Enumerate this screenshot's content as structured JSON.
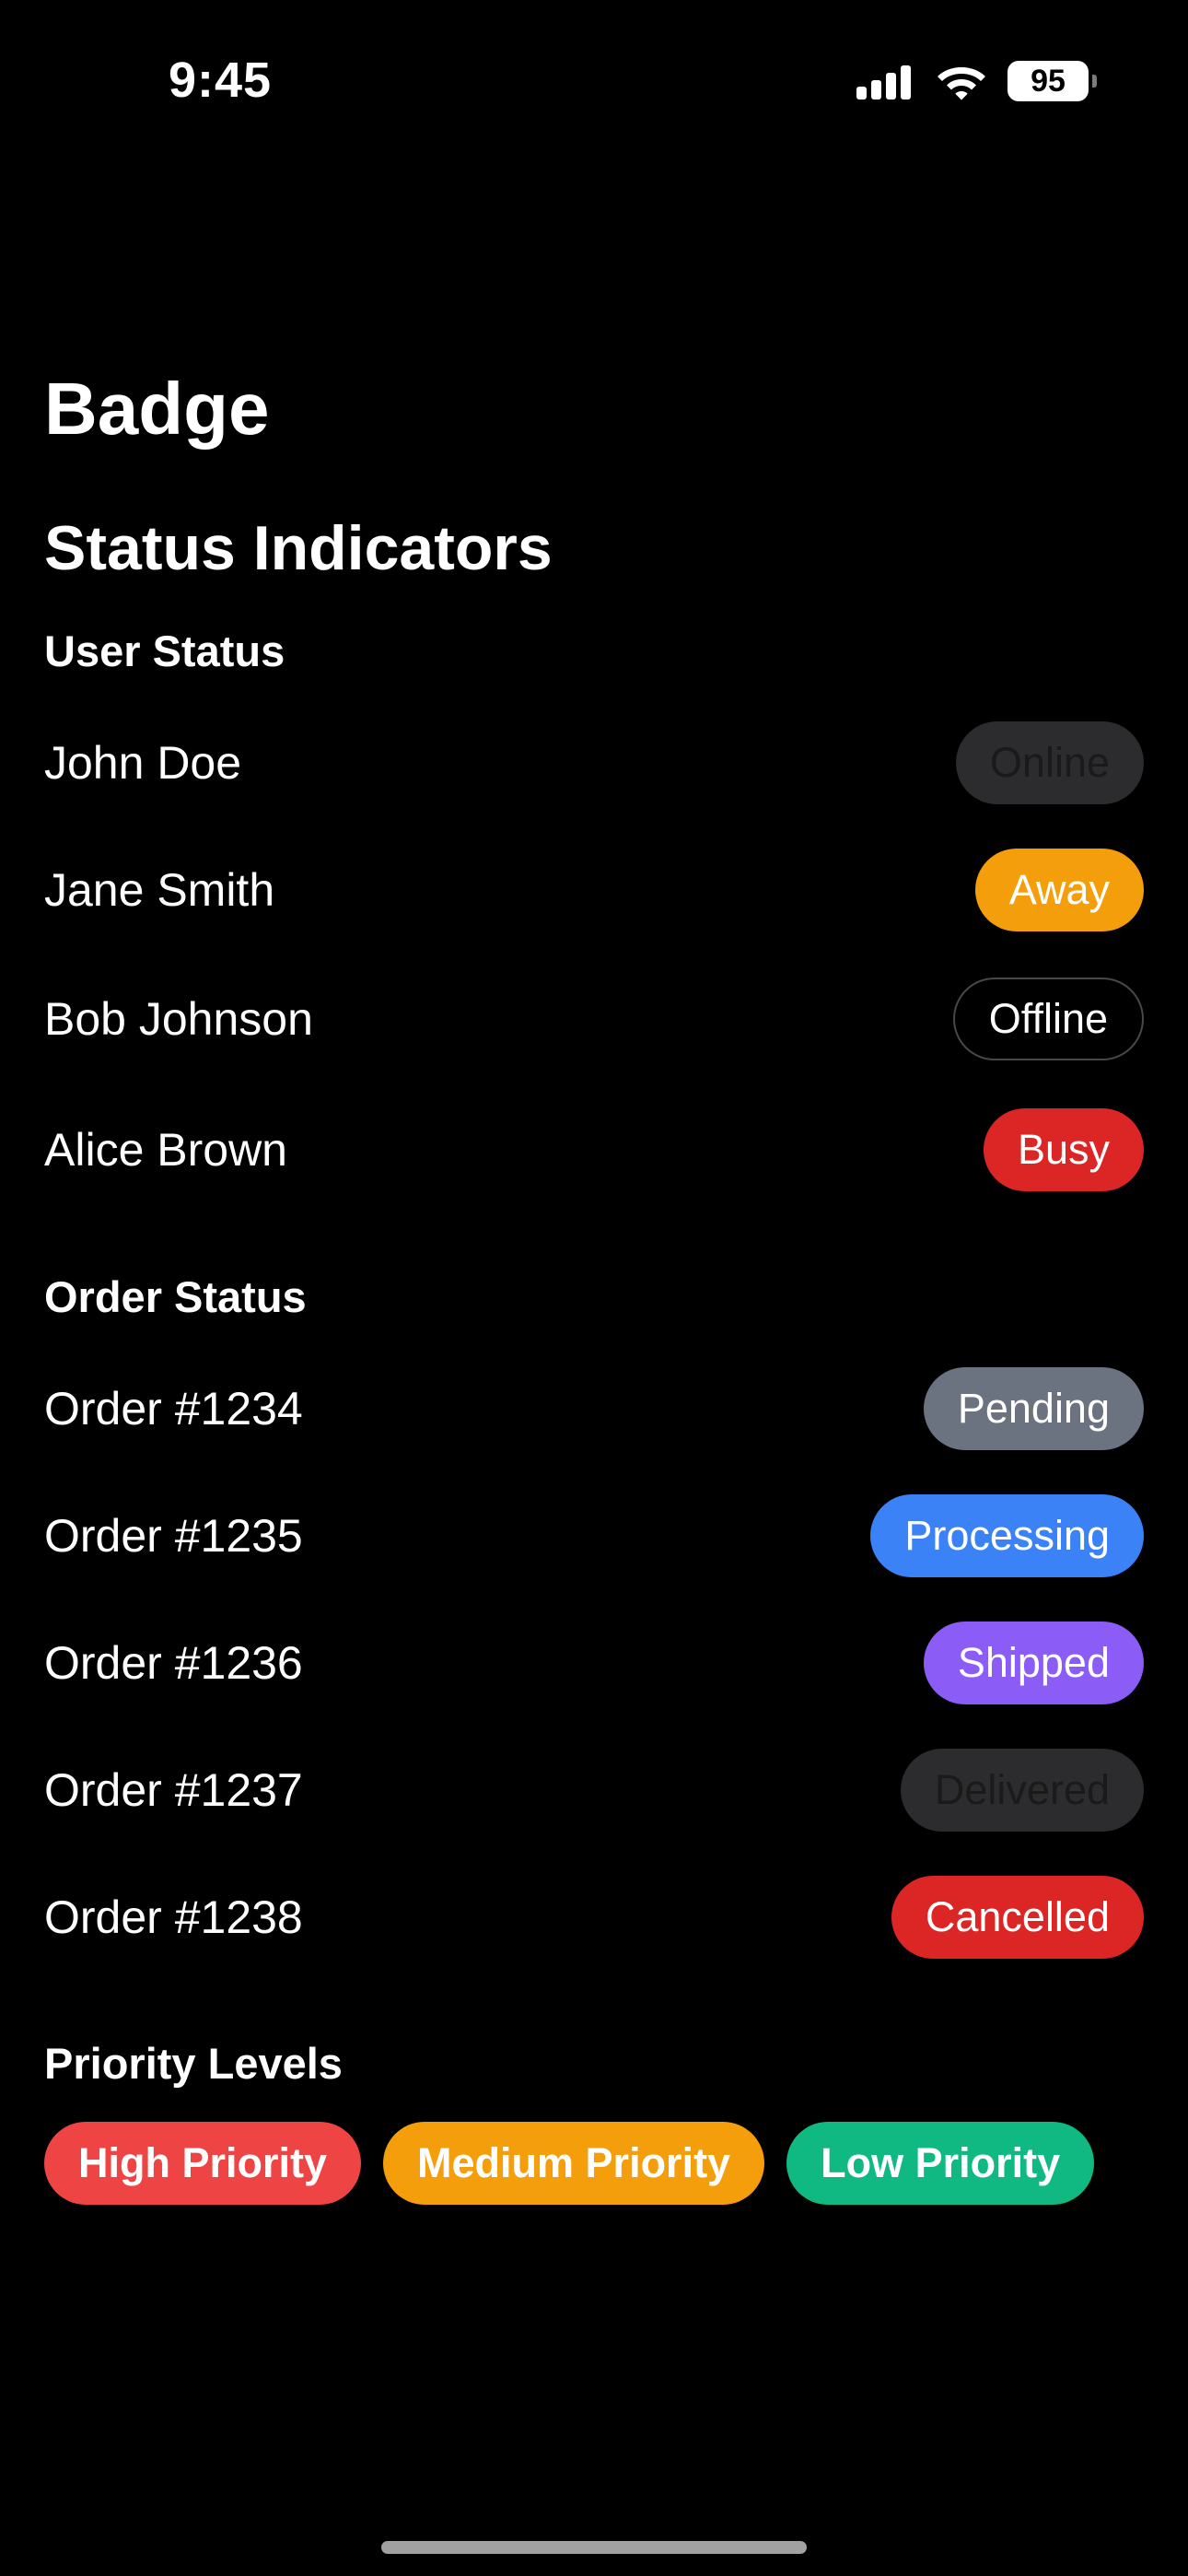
{
  "status_bar": {
    "time": "9:45",
    "battery_level": "95",
    "icons": [
      "signal-icon",
      "wifi-icon",
      "battery-icon"
    ]
  },
  "page": {
    "title": "Badge",
    "section_title": "Status Indicators"
  },
  "user_status": {
    "heading": "User Status",
    "rows": [
      {
        "name": "John Doe",
        "badge": "Online",
        "color": "#2c2c2e"
      },
      {
        "name": "Jane Smith",
        "badge": "Away",
        "color": "#f59e0b"
      },
      {
        "name": "Bob Johnson",
        "badge": "Offline",
        "color": "#000000"
      },
      {
        "name": "Alice Brown",
        "badge": "Busy",
        "color": "#dc2626"
      }
    ]
  },
  "order_status": {
    "heading": "Order Status",
    "rows": [
      {
        "name": "Order #1234",
        "badge": "Pending",
        "color": "#6b7280"
      },
      {
        "name": "Order #1235",
        "badge": "Processing",
        "color": "#3b82f6"
      },
      {
        "name": "Order #1236",
        "badge": "Shipped",
        "color": "#8b5cf6"
      },
      {
        "name": "Order #1237",
        "badge": "Delivered",
        "color": "#2c2c2e"
      },
      {
        "name": "Order #1238",
        "badge": "Cancelled",
        "color": "#dc2626"
      }
    ]
  },
  "priority_levels": {
    "heading": "Priority Levels",
    "badges": [
      {
        "label": "High Priority",
        "color": "#ef4444"
      },
      {
        "label": "Medium Priority",
        "color": "#f59e0b"
      },
      {
        "label": "Low Priority",
        "color": "#10b981"
      }
    ]
  }
}
